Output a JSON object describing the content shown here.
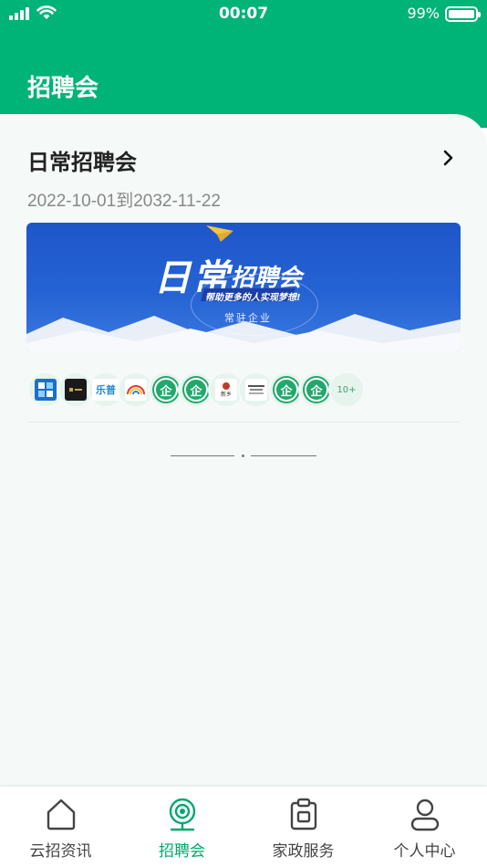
{
  "status_bar": {
    "time": "00:07",
    "battery": "99%"
  },
  "header": {
    "title": "招聘会"
  },
  "fair": {
    "title": "日常招聘会",
    "dates": "2022-10-01到2032-11-22",
    "banner": {
      "title_big": "日常",
      "title_small": "招聘会",
      "slogan": "帮助更多的人实现梦想!",
      "sub": "常驻企业"
    },
    "company_logos": [
      {
        "icon": "grid-logo"
      },
      {
        "icon": "dark-logo"
      },
      {
        "icon": "lexin-logo",
        "text": "乐普"
      },
      {
        "icon": "rainbow-logo"
      },
      {
        "icon": "qi-logo",
        "text": "企"
      },
      {
        "icon": "qi-logo",
        "text": "企"
      },
      {
        "icon": "xinxiangcun-logo",
        "text": "新乡"
      },
      {
        "icon": "text-logo"
      },
      {
        "icon": "qi-logo",
        "text": "企"
      },
      {
        "icon": "qi-logo",
        "text": "企"
      }
    ],
    "more_count": "10+"
  },
  "tabbar": {
    "items": [
      {
        "label": "云招资讯",
        "icon": "home-icon"
      },
      {
        "label": "招聘会",
        "icon": "webcam-icon",
        "active": true
      },
      {
        "label": "家政服务",
        "icon": "clipboard-icon"
      },
      {
        "label": "个人中心",
        "icon": "user-icon"
      }
    ]
  },
  "colors": {
    "brand": "#00b377",
    "active_tab": "#00a86b",
    "banner_blue": "#2563d4"
  }
}
